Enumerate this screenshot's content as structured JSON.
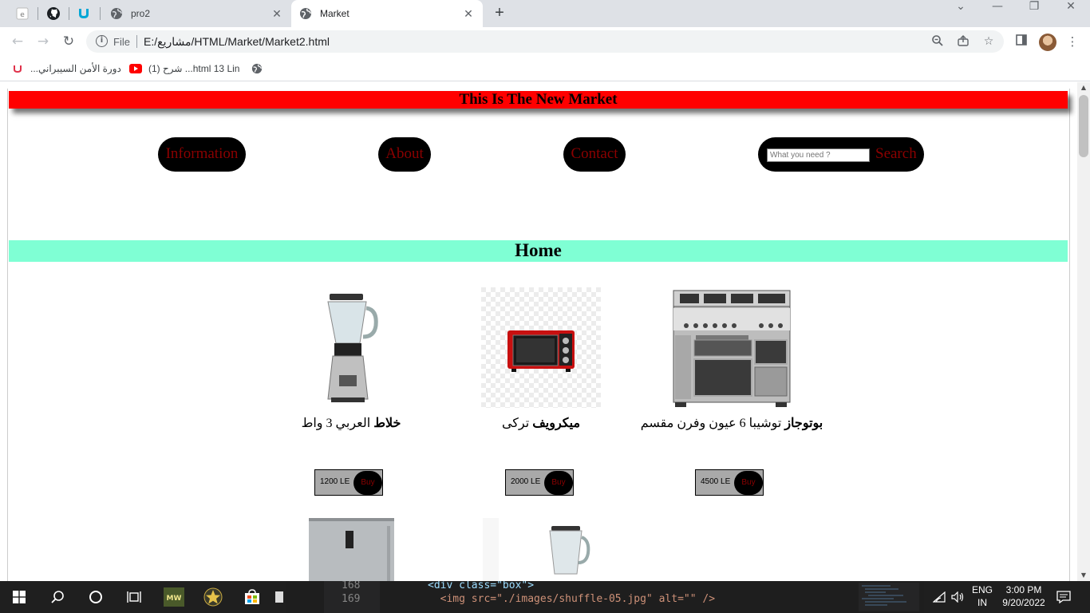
{
  "browser": {
    "tabs": [
      {
        "title": "pro2",
        "active": false
      },
      {
        "title": "Market",
        "active": true
      }
    ],
    "url_scheme": "File",
    "url": "E:/مشاريع/HTML/Market/Market2.html",
    "bookmarks": [
      {
        "label": "دورة الأمن السيبراني..."
      },
      {
        "label": "(1) شرح ...html 13 Lin"
      }
    ]
  },
  "page": {
    "header": "This Is The New Market",
    "nav": {
      "information": "Information",
      "about": "About",
      "contact": "Contact",
      "search_placeholder": "What you need ?",
      "search_button": "Search"
    },
    "section_title": "Home",
    "products": [
      {
        "name_bold": "بوتوجاز",
        "name_rest": " توشيبا 6 عيون وفرن مقسم",
        "price": "4500 LE",
        "buy": "Buy",
        "image": "gas-stove-image"
      },
      {
        "name_bold": "ميكرويف",
        "name_rest": " تركى",
        "price": "2000 LE",
        "buy": "Buy",
        "image": "microwave-oven-image"
      },
      {
        "name_bold": "خلاط",
        "name_rest": " العربي 3 واط",
        "price": "1200 LE",
        "buy": "Buy",
        "image": "blender-image"
      }
    ]
  },
  "taskbar": {
    "code_lines": [
      {
        "num": "168",
        "text": "<div class=\"box\">"
      },
      {
        "num": "169",
        "text": "  <img src=\"./images/shuffle-05.jpg\" alt=\"\" />"
      }
    ],
    "language_1": "ENG",
    "language_2": "IN",
    "time": "3:00 PM",
    "date": "9/20/2022"
  },
  "colors": {
    "header_bg": "#ff0000",
    "section_bg": "#7fffd4",
    "pill_bg": "#000000",
    "pill_text": "#8b0000",
    "price_bg": "#a9a9a9"
  }
}
